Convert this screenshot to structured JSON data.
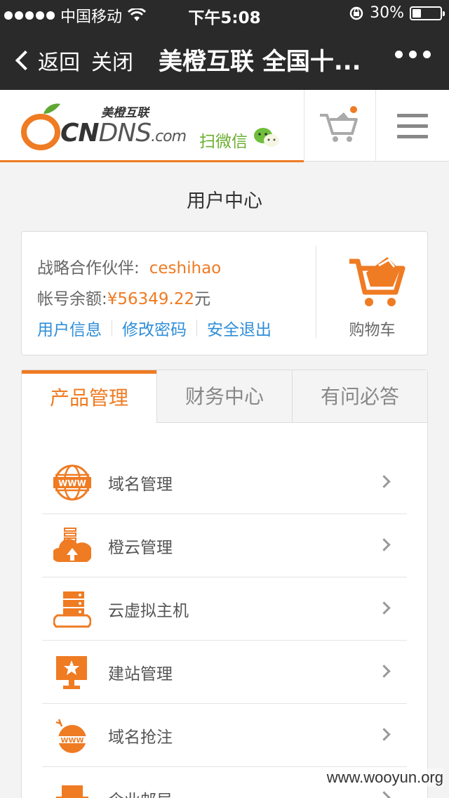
{
  "status_bar": {
    "carrier": "中国移动",
    "time": "下午5:08",
    "battery": "30%"
  },
  "navbar": {
    "back_label": "返回",
    "close_label": "关闭",
    "title": "美橙互联 全国十..."
  },
  "site_header": {
    "logo_cn": "美橙互联",
    "logo_text_a": "CN",
    "logo_text_b": "DNS",
    "logo_text_c": ".com",
    "scan_label": "扫微信",
    "accent": "#ef7b23"
  },
  "page_title": "用户中心",
  "user_card": {
    "partner_label": "战略合作伙伴:",
    "partner_value": "ceshihao",
    "balance_label": "帐号余额:",
    "balance_value": "¥56349.22",
    "balance_unit": "元",
    "links": [
      "用户信息",
      "修改密码",
      "安全退出"
    ],
    "cart_label": "购物车"
  },
  "tabs": [
    {
      "label": "产品管理",
      "active": true
    },
    {
      "label": "财务中心",
      "active": false
    },
    {
      "label": "有问必答",
      "active": false
    }
  ],
  "menu": [
    {
      "label": "域名管理",
      "icon": "www-globe-icon"
    },
    {
      "label": "橙云管理",
      "icon": "cloud-server-icon"
    },
    {
      "label": "云虚拟主机",
      "icon": "server-stack-icon"
    },
    {
      "label": "建站管理",
      "icon": "monitor-star-icon"
    },
    {
      "label": "域名抢注",
      "icon": "www-bomb-icon"
    },
    {
      "label": "企业邮局",
      "icon": "mail-icon"
    }
  ],
  "watermark": "www.wooyun.org"
}
